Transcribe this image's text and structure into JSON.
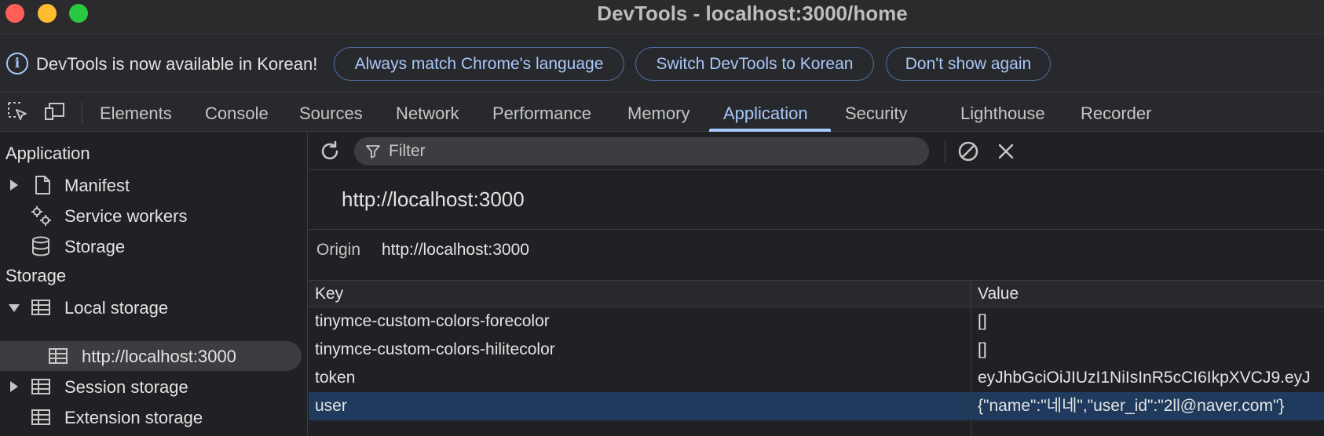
{
  "window": {
    "title": "DevTools - localhost:3000/home"
  },
  "infobar": {
    "message": "DevTools is now available in Korean!",
    "buttons": [
      "Always match Chrome's language",
      "Switch DevTools to Korean",
      "Don't show again"
    ]
  },
  "tabs": {
    "items": [
      "Elements",
      "Console",
      "Sources",
      "Network",
      "Performance",
      "Memory",
      "Application",
      "Security",
      "Lighthouse",
      "Recorder"
    ],
    "active": "Application"
  },
  "sidebar": {
    "application_header": "Application",
    "application_items": [
      "Manifest",
      "Service workers",
      "Storage"
    ],
    "storage_header": "Storage",
    "storage_items": {
      "local_storage": "Local storage",
      "local_origin": "http://localhost:3000",
      "session_storage": "Session storage",
      "extension_storage": "Extension storage"
    }
  },
  "main": {
    "filter_placeholder": "Filter",
    "origin_title": "http://localhost:3000",
    "origin_label": "Origin",
    "origin_value": "http://localhost:3000",
    "table": {
      "headers": [
        "Key",
        "Value"
      ],
      "rows": [
        {
          "key": "tinymce-custom-colors-forecolor",
          "value": "[]"
        },
        {
          "key": "tinymce-custom-colors-hilitecolor",
          "value": "[]"
        },
        {
          "key": "token",
          "value": "eyJhbGciOiJIUzI1NiIsInR5cCI6IkpXVCJ9.eyJ"
        },
        {
          "key": "user",
          "value": "{\"name\":\"네네\",\"user_id\":\"2ll@naver.com\"}"
        }
      ],
      "selected_row": 3
    }
  },
  "colors": {
    "accent": "#a8c7fa",
    "selected_row": "#1f3a5c",
    "background": "#202124"
  }
}
